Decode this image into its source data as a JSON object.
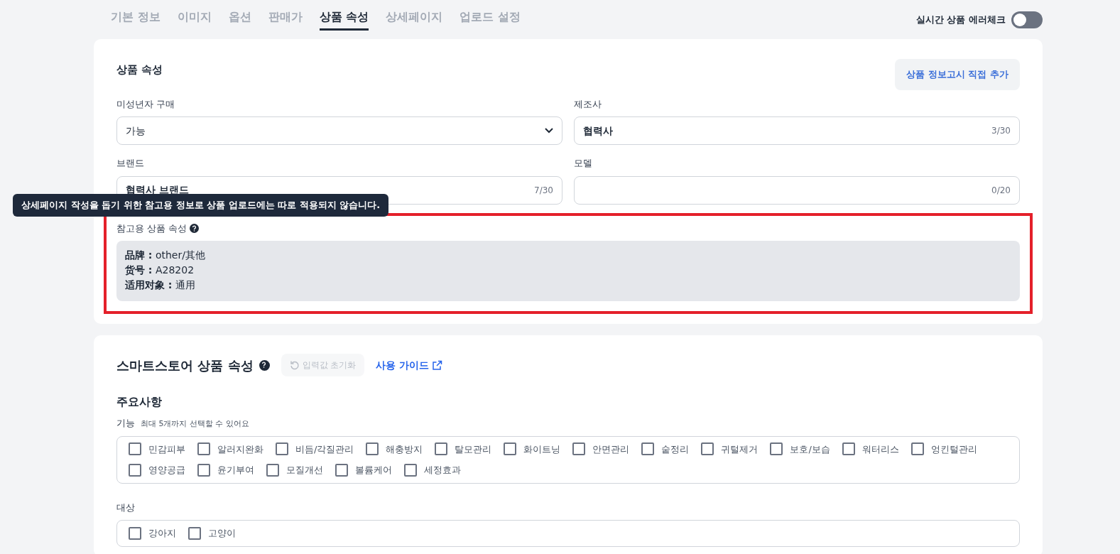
{
  "tabs": [
    {
      "label": "기본 정보",
      "selected": false
    },
    {
      "label": "이미지",
      "selected": false
    },
    {
      "label": "옵션",
      "selected": false
    },
    {
      "label": "판매가",
      "selected": false
    },
    {
      "label": "상품 속성",
      "selected": true
    },
    {
      "label": "상세페이지",
      "selected": false
    },
    {
      "label": "업로드 설정",
      "selected": false
    }
  ],
  "error_check_toggle": {
    "label": "실시간 상품 에러체크",
    "on": false
  },
  "product_attributes": {
    "title": "상품 속성",
    "notice_button": "상품 정보고시 직접 추가",
    "fields": [
      {
        "label": "미성년자 구매",
        "kind": "select",
        "value": "가능"
      },
      {
        "label": "제조사",
        "kind": "text",
        "value": "협력사",
        "counter": "3/30"
      },
      {
        "label": "브랜드",
        "kind": "text",
        "value": "협력사 브랜드",
        "counter": "7/30"
      },
      {
        "label": "모델",
        "kind": "text",
        "counter": "0/20"
      }
    ],
    "tooltip": "상세페이지 작성을 돕기 위한 참고용 정보로 상품 업로드에는 따로 적용되지 않습니다.",
    "reference": {
      "label": "참고용 상품 속성",
      "highlighted": true,
      "lines": [
        {
          "key": "品牌 :",
          "value": "other/其他"
        },
        {
          "key": "货号 :",
          "value": "A28202"
        },
        {
          "key": "适用对象 :",
          "value": "通用"
        }
      ]
    }
  },
  "smartstore": {
    "title": "스마트스토어 상품 속성",
    "reset_button": {
      "label": "입력값 초기화",
      "disabled": true
    },
    "guide_link": "사용 가이드",
    "section_title": "주요사항",
    "groups": [
      {
        "label": "기능",
        "hint": "최대 5개까지 선택할 수 있어요",
        "options": [
          {
            "label": "민감피부",
            "checked": false
          },
          {
            "label": "알러지완화",
            "checked": false
          },
          {
            "label": "비듬/각질관리",
            "checked": false
          },
          {
            "label": "해충방지",
            "checked": false
          },
          {
            "label": "탈모관리",
            "checked": false
          },
          {
            "label": "화이트닝",
            "checked": false
          },
          {
            "label": "안면관리",
            "checked": false
          },
          {
            "label": "숱정리",
            "checked": false
          },
          {
            "label": "귀털제거",
            "checked": false
          },
          {
            "label": "보호/보습",
            "checked": false
          },
          {
            "label": "워터리스",
            "checked": false
          },
          {
            "label": "엉킨털관리",
            "checked": false
          },
          {
            "label": "영양공급",
            "checked": false
          },
          {
            "label": "윤기부여",
            "checked": false
          },
          {
            "label": "모질개선",
            "checked": false
          },
          {
            "label": "볼륨케어",
            "checked": false
          },
          {
            "label": "세정효과",
            "checked": false
          }
        ]
      },
      {
        "label": "대상",
        "options": [
          {
            "label": "강아지",
            "checked": false
          },
          {
            "label": "고양이",
            "checked": false
          }
        ]
      }
    ]
  }
}
